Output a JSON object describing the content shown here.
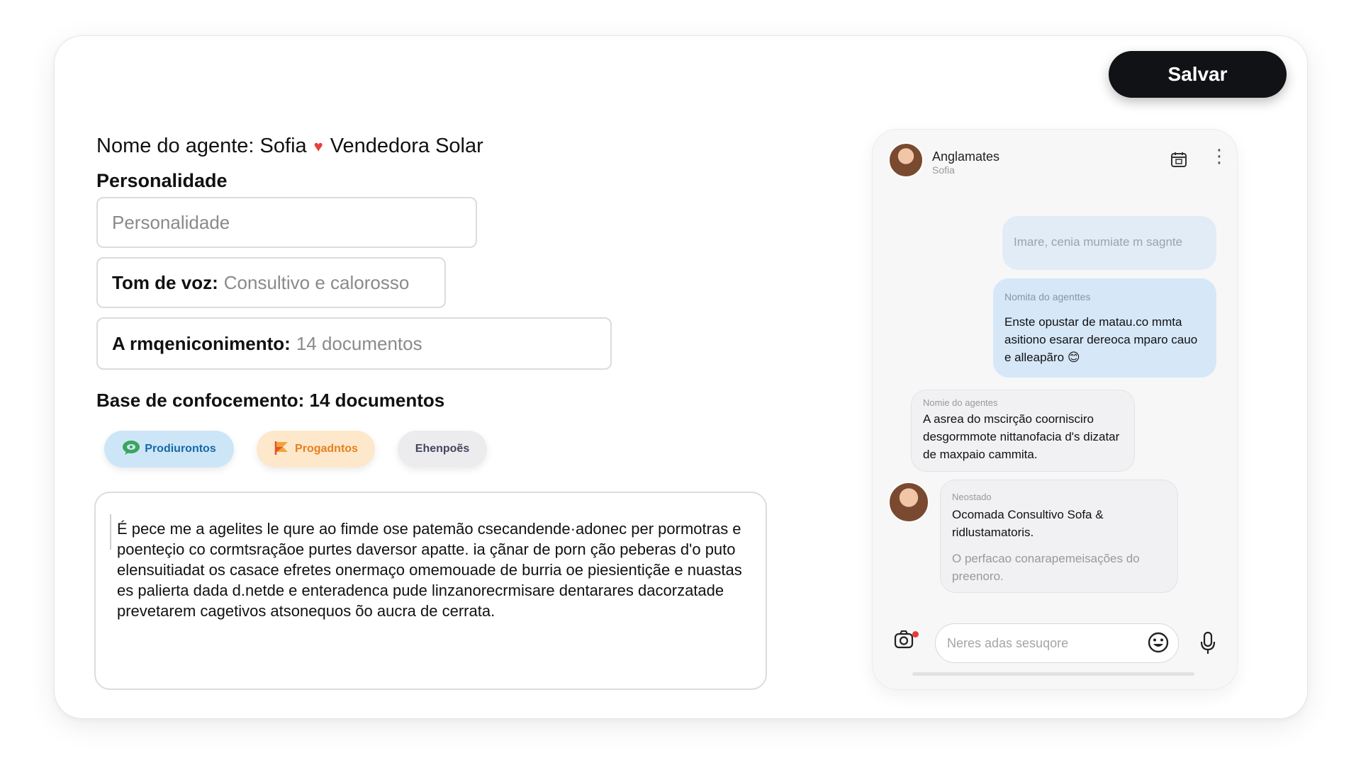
{
  "header": {
    "save_label": "Salvar"
  },
  "agent": {
    "name_label": "Nome do agente: Sofia",
    "role": "Vendedora Solar",
    "personality_label": "Personalidade",
    "personality_placeholder": "Personalidade",
    "tone_key": "Tom de voz:",
    "tone_value": "Consultivo e calorosso",
    "knowledge_key": "A rmqeniconimento:",
    "knowledge_value": "14 documentos",
    "base_label": "Base de confocemento: 14 documentos"
  },
  "chips": [
    {
      "label": "Prodiurontos",
      "icon": "chat-icon"
    },
    {
      "label": "Progadntos",
      "icon": "flag-icon"
    },
    {
      "label": "Ehenpoẽs"
    }
  ],
  "description": "É pece me a agelites le qure ao fimde ose patemão csecandende·adonec per pormotras e poenteçio co cormtsraçãoe purtes daversor apatte. ia çãnar de porn ção peberas d'o puto elensuitiadat os casace efretes onermaço omemouade de burria oe piesientiçãe e nuastas es palierta dada d.netde e enteradenca pude linzanorecrmisare dentarares dacorzatade prevetarem cagetivos atsonequos õo aucra de cerrata.",
  "phone": {
    "title": "Anglamates",
    "subtitle": "Sofia",
    "messages": [
      {
        "text": "Imare, cenia mumiate m sagnte"
      },
      {
        "header": "Nomita do agenttes",
        "text": "Enste opustar de matau.co mmta asitiono esarar dereoca mparo cauo e alleapãro 😊"
      },
      {
        "header": "Nomie do agentes",
        "text": "A asrea do mscirção coorniscirо desgormmote nittanofacia d's dizatar de maxpaio cammita."
      },
      {
        "header": "Neostado",
        "text": "Ocomada Consultivo Sofa & ridlustamatoris.",
        "sub": "O perfacao conarapemeisações do preenoro."
      }
    ],
    "input_placeholder": "Neres adas sesuqore"
  }
}
